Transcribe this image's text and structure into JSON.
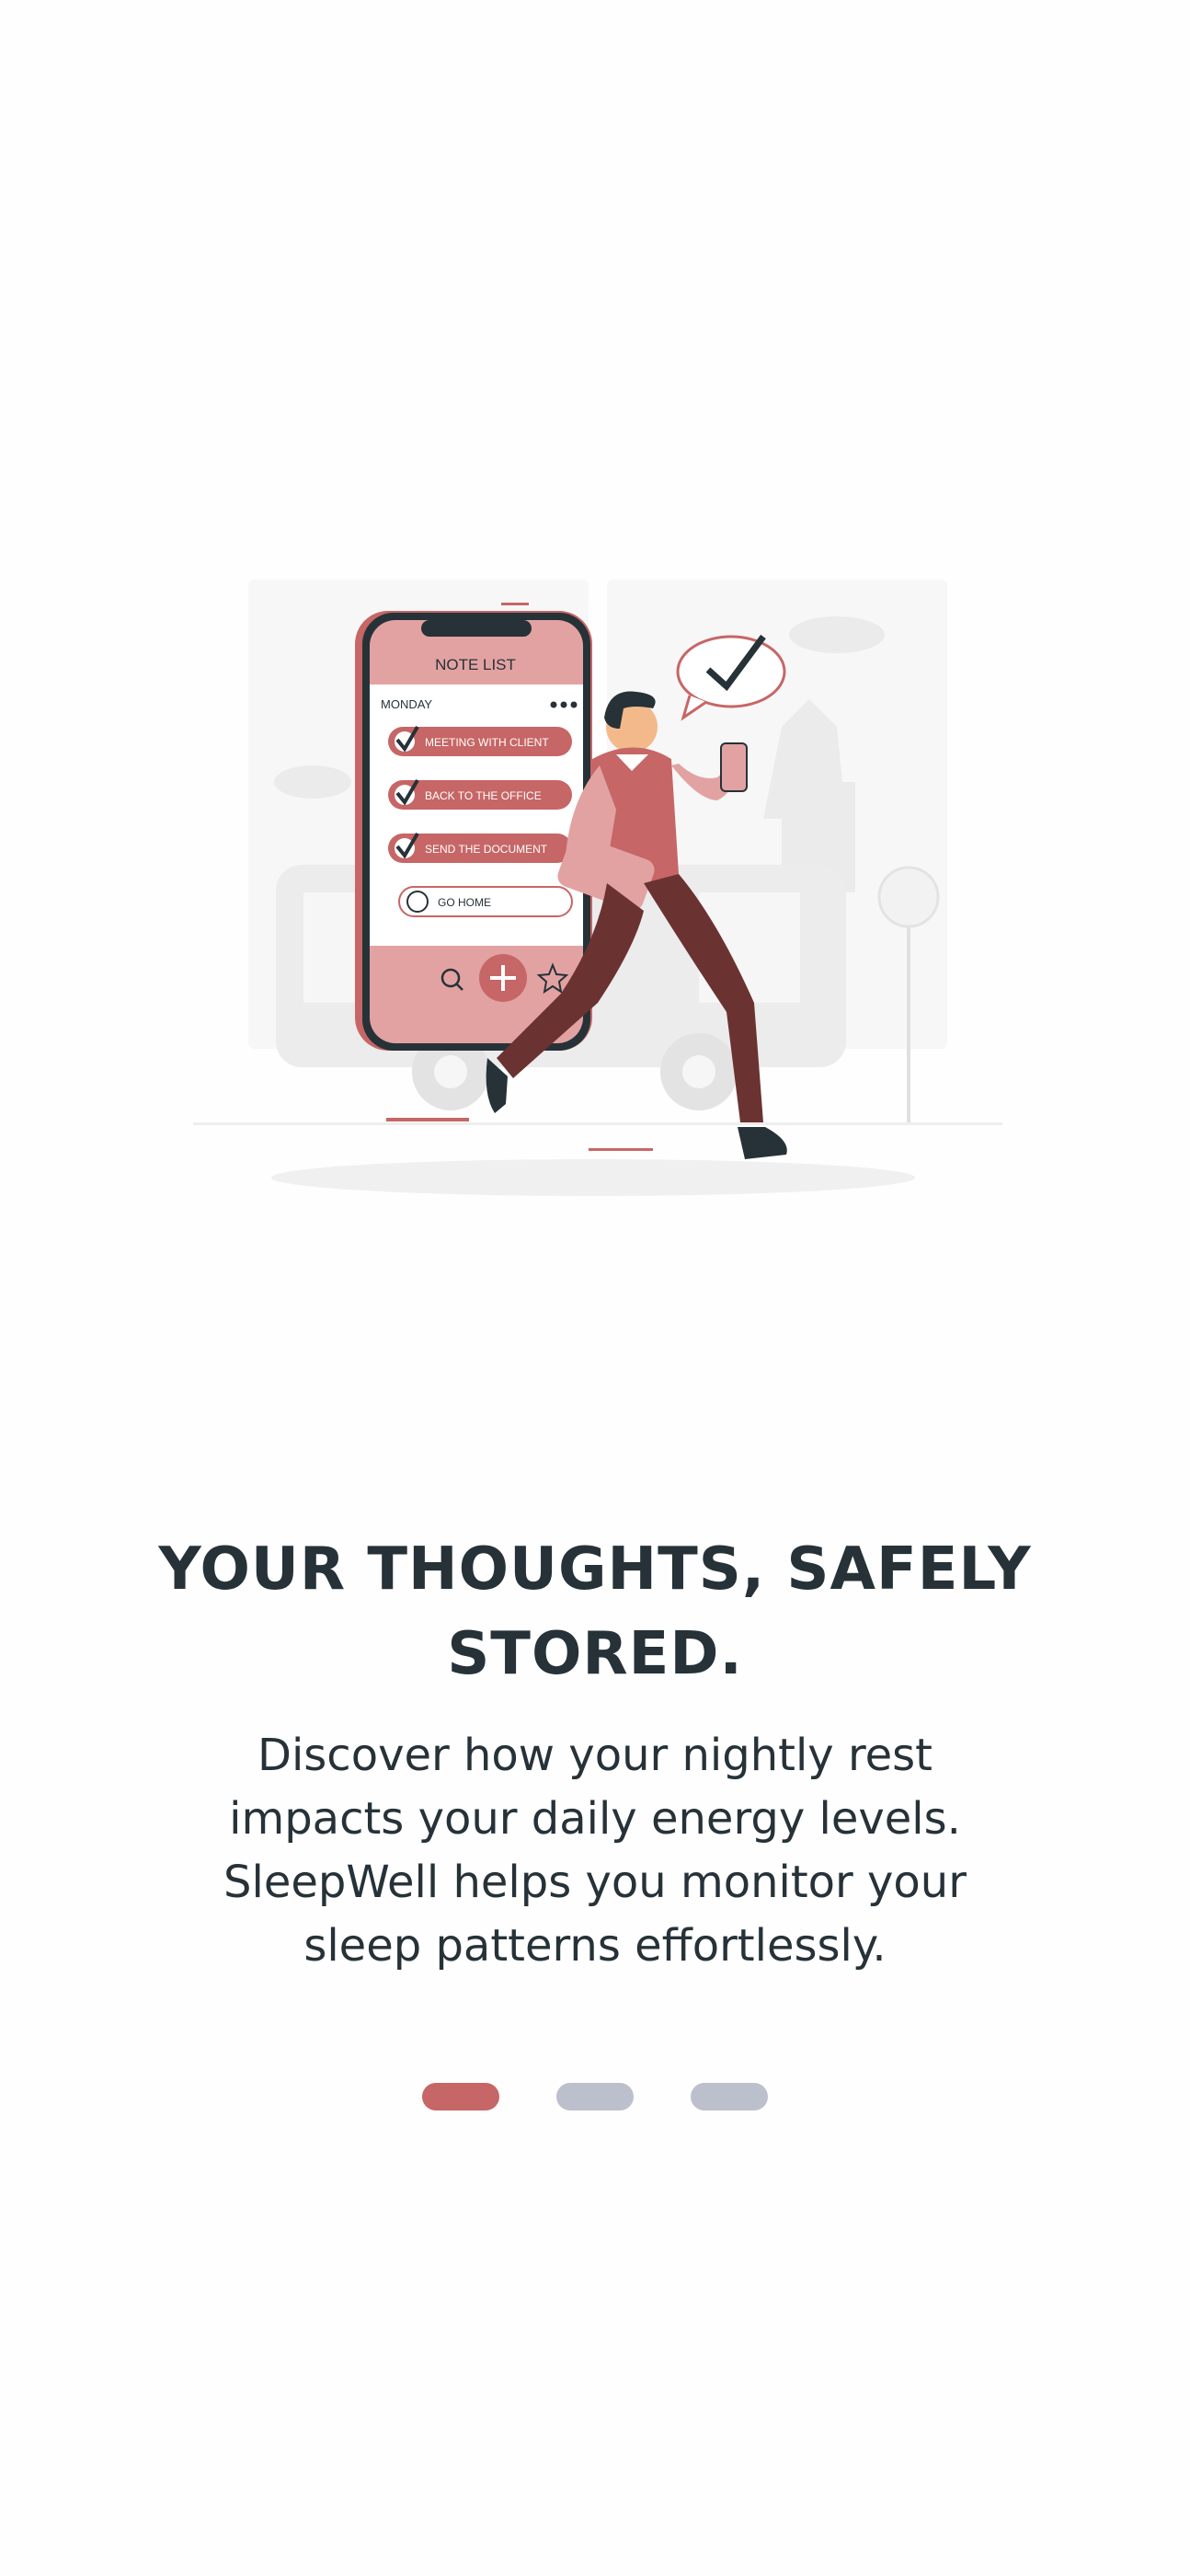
{
  "onboarding": {
    "illustration": {
      "phone_title": "NOTE LIST",
      "day_label": "MONDAY",
      "tasks": [
        {
          "label": "MEETING WITH CLIENT",
          "done": true
        },
        {
          "label": "BACK TO THE OFFICE",
          "done": true
        },
        {
          "label": "SEND THE DOCUMENT",
          "done": true
        },
        {
          "label": "GO HOME",
          "done": false
        }
      ]
    },
    "headline_lines": [
      "YOUR THOUGHTS, SAFELY",
      "STORED."
    ],
    "body_lines": [
      "Discover how your nightly rest",
      "impacts your daily energy levels.",
      "SleepWell helps you monitor your",
      "sleep patterns effortlessly."
    ],
    "pager": {
      "count": 3,
      "active_index": 0
    }
  },
  "colors": {
    "accent": "#c76666",
    "inactive_dot": "#bcc0cc",
    "text": "#263238",
    "background": "#fefefe"
  }
}
